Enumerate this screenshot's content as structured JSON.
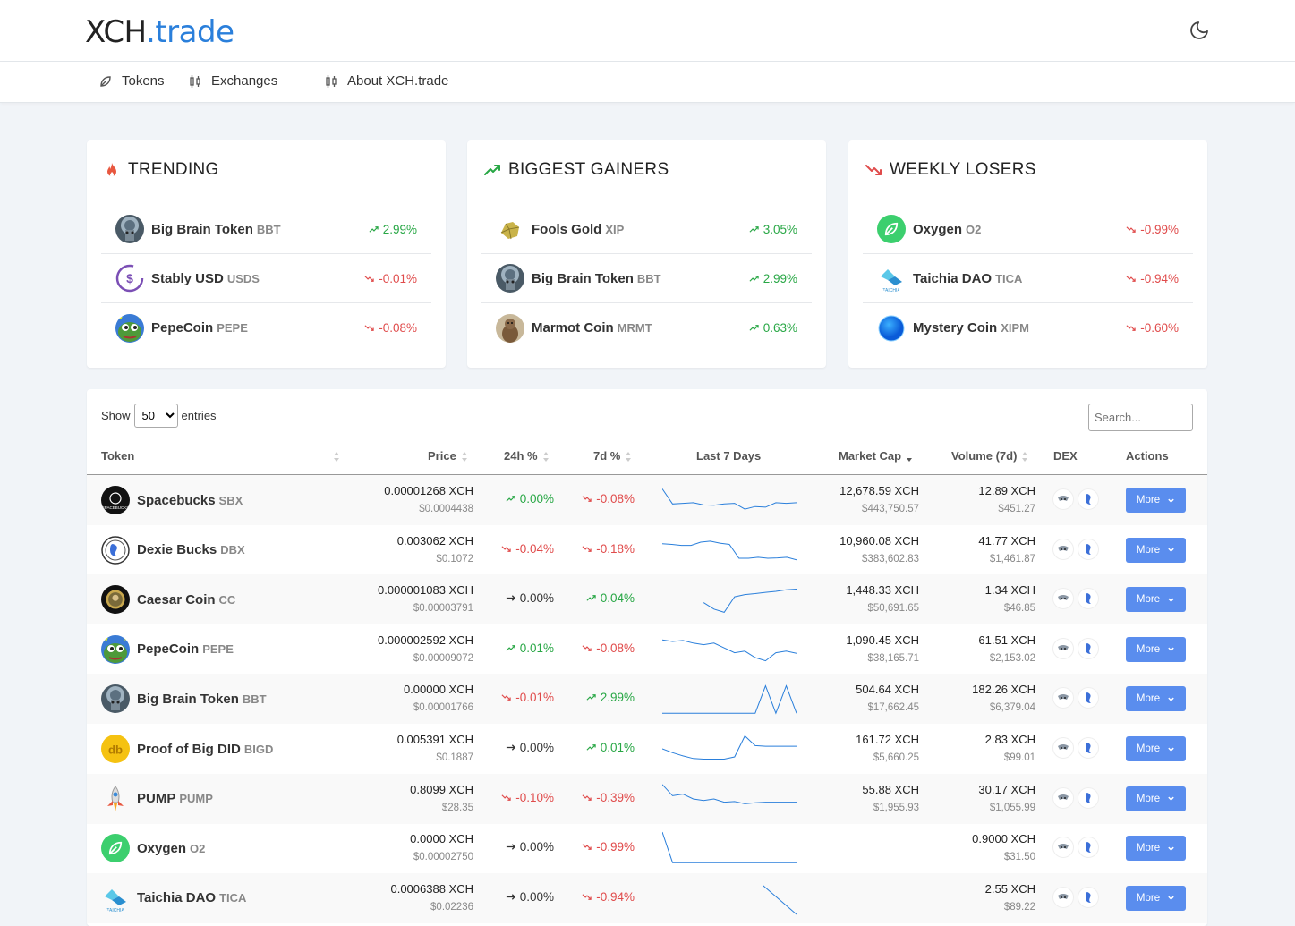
{
  "logo": {
    "part1": "XCH",
    "part2": ".trade"
  },
  "nav": [
    {
      "label": "Tokens",
      "icon": "leaf-icon"
    },
    {
      "label": "Exchanges",
      "icon": "candles-icon"
    },
    {
      "label": "About XCH.trade",
      "icon": "candles-icon"
    }
  ],
  "cards": [
    {
      "title": "TRENDING",
      "icon": "fire-icon",
      "icon_color": "#e8573f",
      "items": [
        {
          "name": "Big Brain Token",
          "symbol": "BBT",
          "change": "2.99%",
          "dir": "up",
          "icon": "bbt"
        },
        {
          "name": "Stably USD",
          "symbol": "USDS",
          "change": "-0.01%",
          "dir": "down",
          "icon": "usds"
        },
        {
          "name": "PepeCoin",
          "symbol": "PEPE",
          "change": "-0.08%",
          "dir": "down",
          "icon": "pepe"
        }
      ]
    },
    {
      "title": "BIGGEST GAINERS",
      "icon": "trend-up-icon",
      "icon_color": "#28a745",
      "items": [
        {
          "name": "Fools Gold",
          "symbol": "XIP",
          "change": "3.05%",
          "dir": "up",
          "icon": "gold"
        },
        {
          "name": "Big Brain Token",
          "symbol": "BBT",
          "change": "2.99%",
          "dir": "up",
          "icon": "bbt"
        },
        {
          "name": "Marmot Coin",
          "symbol": "MRMT",
          "change": "0.63%",
          "dir": "up",
          "icon": "marmot"
        }
      ]
    },
    {
      "title": "WEEKLY LOSERS",
      "icon": "trend-down-icon",
      "icon_color": "#e04b4b",
      "items": [
        {
          "name": "Oxygen",
          "symbol": "O2",
          "change": "-0.99%",
          "dir": "down",
          "icon": "oxygen"
        },
        {
          "name": "Taichia DAO",
          "symbol": "TICA",
          "change": "-0.94%",
          "dir": "down",
          "icon": "tica"
        },
        {
          "name": "Mystery Coin",
          "symbol": "XIPM",
          "change": "-0.60%",
          "dir": "down",
          "icon": "mystery"
        }
      ]
    }
  ],
  "table": {
    "show_label": "Show",
    "entries_label": "entries",
    "page_size": "50",
    "search_placeholder": "Search...",
    "columns": [
      "Token",
      "Price",
      "24h %",
      "7d %",
      "Last 7 Days",
      "Market Cap",
      "Volume (7d)",
      "DEX",
      "Actions"
    ],
    "more_label": "More",
    "rows": [
      {
        "name": "Spacebucks",
        "symbol": "SBX",
        "icon": "sbx",
        "price_xch": "0.00001268 XCH",
        "price_usd": "$0.0004438",
        "h24": "0.00%",
        "h24_dir": "up",
        "d7": "-0.08%",
        "d7_dir": "down",
        "mcap_xch": "12,678.59 XCH",
        "mcap_usd": "$443,750.57",
        "vol_xch": "12.89 XCH",
        "vol_usd": "$451.27",
        "spark": [
          0.15,
          0.62,
          0.6,
          0.58,
          0.65,
          0.66,
          0.62,
          0.6,
          0.78,
          0.7,
          0.72,
          0.58,
          0.6,
          0.58
        ]
      },
      {
        "name": "Dexie Bucks",
        "symbol": "DBX",
        "icon": "dbx",
        "price_xch": "0.003062 XCH",
        "price_usd": "$0.1072",
        "h24": "-0.04%",
        "h24_dir": "down",
        "d7": "-0.18%",
        "d7_dir": "down",
        "mcap_xch": "10,960.08 XCH",
        "mcap_usd": "$383,602.83",
        "vol_xch": "41.77 XCH",
        "vol_usd": "$1,461.87",
        "spark": [
          0.3,
          0.32,
          0.35,
          0.35,
          0.25,
          0.22,
          0.28,
          0.32,
          0.75,
          0.75,
          0.72,
          0.75,
          0.74,
          0.72,
          0.8
        ]
      },
      {
        "name": "Caesar Coin",
        "symbol": "CC",
        "icon": "cc",
        "price_xch": "0.000001083 XCH",
        "price_usd": "$0.00003791",
        "h24": "0.00%",
        "h24_dir": "flat",
        "d7": "0.04%",
        "d7_dir": "up",
        "mcap_xch": "1,448.33 XCH",
        "mcap_usd": "$50,691.65",
        "vol_xch": "1.34 XCH",
        "vol_usd": "$46.85",
        "spark": [
          null,
          null,
          null,
          null,
          0.6,
          0.8,
          0.9,
          0.42,
          0.35,
          0.32,
          0.28,
          0.25,
          0.2,
          0.18
        ]
      },
      {
        "name": "PepeCoin",
        "symbol": "PEPE",
        "icon": "pepe",
        "price_xch": "0.000002592 XCH",
        "price_usd": "$0.00009072",
        "h24": "0.01%",
        "h24_dir": "up",
        "d7": "-0.08%",
        "d7_dir": "down",
        "mcap_xch": "1,090.45 XCH",
        "mcap_usd": "$38,165.71",
        "vol_xch": "61.51 XCH",
        "vol_usd": "$2,153.02",
        "spark": [
          0.2,
          0.25,
          0.22,
          0.3,
          0.35,
          0.3,
          0.45,
          0.6,
          0.55,
          0.75,
          0.85,
          0.6,
          0.55,
          0.62
        ]
      },
      {
        "name": "Big Brain Token",
        "symbol": "BBT",
        "icon": "bbt",
        "price_xch": "0.00000 XCH",
        "price_usd": "$0.00001766",
        "h24": "-0.01%",
        "h24_dir": "down",
        "d7": "2.99%",
        "d7_dir": "up",
        "mcap_xch": "504.64 XCH",
        "mcap_usd": "$17,662.45",
        "vol_xch": "182.26 XCH",
        "vol_usd": "$6,379.04",
        "spark": [
          0.95,
          0.95,
          0.95,
          0.95,
          0.95,
          0.95,
          0.95,
          0.95,
          0.95,
          0.95,
          0.1,
          0.95,
          0.1,
          0.95
        ]
      },
      {
        "name": "Proof of Big DID",
        "symbol": "BIGD",
        "icon": "bigd",
        "price_xch": "0.005391 XCH",
        "price_usd": "$0.1887",
        "h24": "0.00%",
        "h24_dir": "flat",
        "d7": "0.01%",
        "d7_dir": "up",
        "mcap_xch": "161.72 XCH",
        "mcap_usd": "$5,660.25",
        "vol_xch": "2.83 XCH",
        "vol_usd": "$99.01",
        "spark": [
          0.5,
          0.62,
          0.72,
          0.8,
          0.82,
          0.82,
          0.82,
          0.75,
          0.1,
          0.4,
          0.42,
          0.42,
          0.42,
          0.42
        ]
      },
      {
        "name": "PUMP",
        "symbol": "PUMP",
        "icon": "pump",
        "price_xch": "0.8099 XCH",
        "price_usd": "$28.35",
        "h24": "-0.10%",
        "h24_dir": "down",
        "d7": "-0.39%",
        "d7_dir": "down",
        "mcap_xch": "55.88 XCH",
        "mcap_usd": "$1,955.93",
        "vol_xch": "30.17 XCH",
        "vol_usd": "$1,055.99",
        "spark": [
          0.05,
          0.4,
          0.35,
          0.5,
          0.55,
          0.5,
          0.6,
          0.58,
          0.65,
          0.62,
          0.6,
          0.6,
          0.6,
          0.6
        ]
      },
      {
        "name": "Oxygen",
        "symbol": "O2",
        "icon": "oxygen",
        "price_xch": "0.0000 XCH",
        "price_usd": "$0.00002750",
        "h24": "0.00%",
        "h24_dir": "flat",
        "d7": "-0.99%",
        "d7_dir": "down",
        "mcap_xch": "",
        "mcap_usd": "",
        "vol_xch": "0.9000 XCH",
        "vol_usd": "$31.50",
        "spark": [
          0.0,
          0.95,
          0.95,
          0.95,
          0.95,
          0.95,
          0.95,
          0.95,
          0.95,
          0.95,
          0.95,
          0.95,
          0.95,
          0.95
        ]
      },
      {
        "name": "Taichia DAO",
        "symbol": "TICA",
        "icon": "tica",
        "price_xch": "0.0006388 XCH",
        "price_usd": "$0.02236",
        "h24": "0.00%",
        "h24_dir": "flat",
        "d7": "-0.94%",
        "d7_dir": "down",
        "mcap_xch": "",
        "mcap_usd": "",
        "vol_xch": "2.55 XCH",
        "vol_usd": "$89.22",
        "spark": [
          null,
          null,
          null,
          0.1,
          1.0
        ]
      }
    ]
  }
}
